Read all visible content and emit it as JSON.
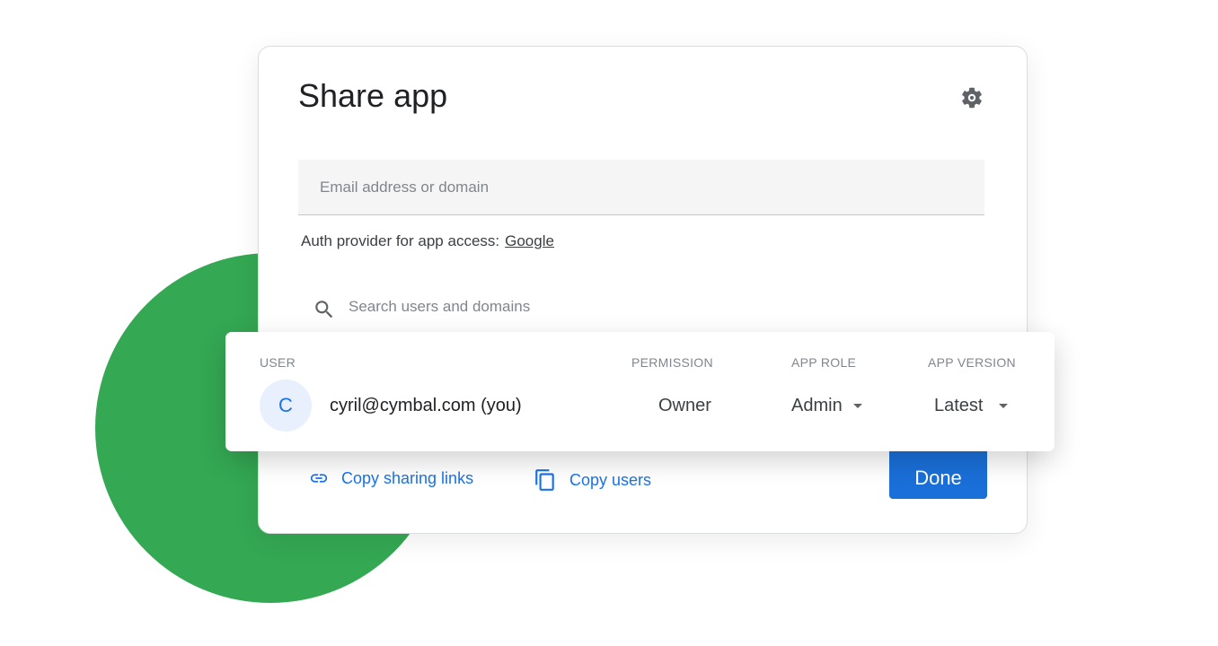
{
  "dialog": {
    "title": "Share app",
    "settings_icon": "gear-icon",
    "email_placeholder": "Email address or domain",
    "auth_label": "Auth provider for app access:",
    "auth_provider": "Google",
    "search_placeholder": "Search users and domains",
    "copy_links": "Copy sharing links",
    "copy_users": "Copy users",
    "done": "Done"
  },
  "table": {
    "headers": {
      "user": "USER",
      "permission": "PERMISSION",
      "role": "APP ROLE",
      "version": "APP VERSION"
    },
    "rows": [
      {
        "initial": "C",
        "email": "cyril@cymbal.com (you)",
        "permission": "Owner",
        "role": "Admin",
        "version": "Latest"
      }
    ]
  },
  "colors": {
    "accent": "#1a73e8",
    "circle": "#34a853",
    "done": "#1a6fd8"
  }
}
